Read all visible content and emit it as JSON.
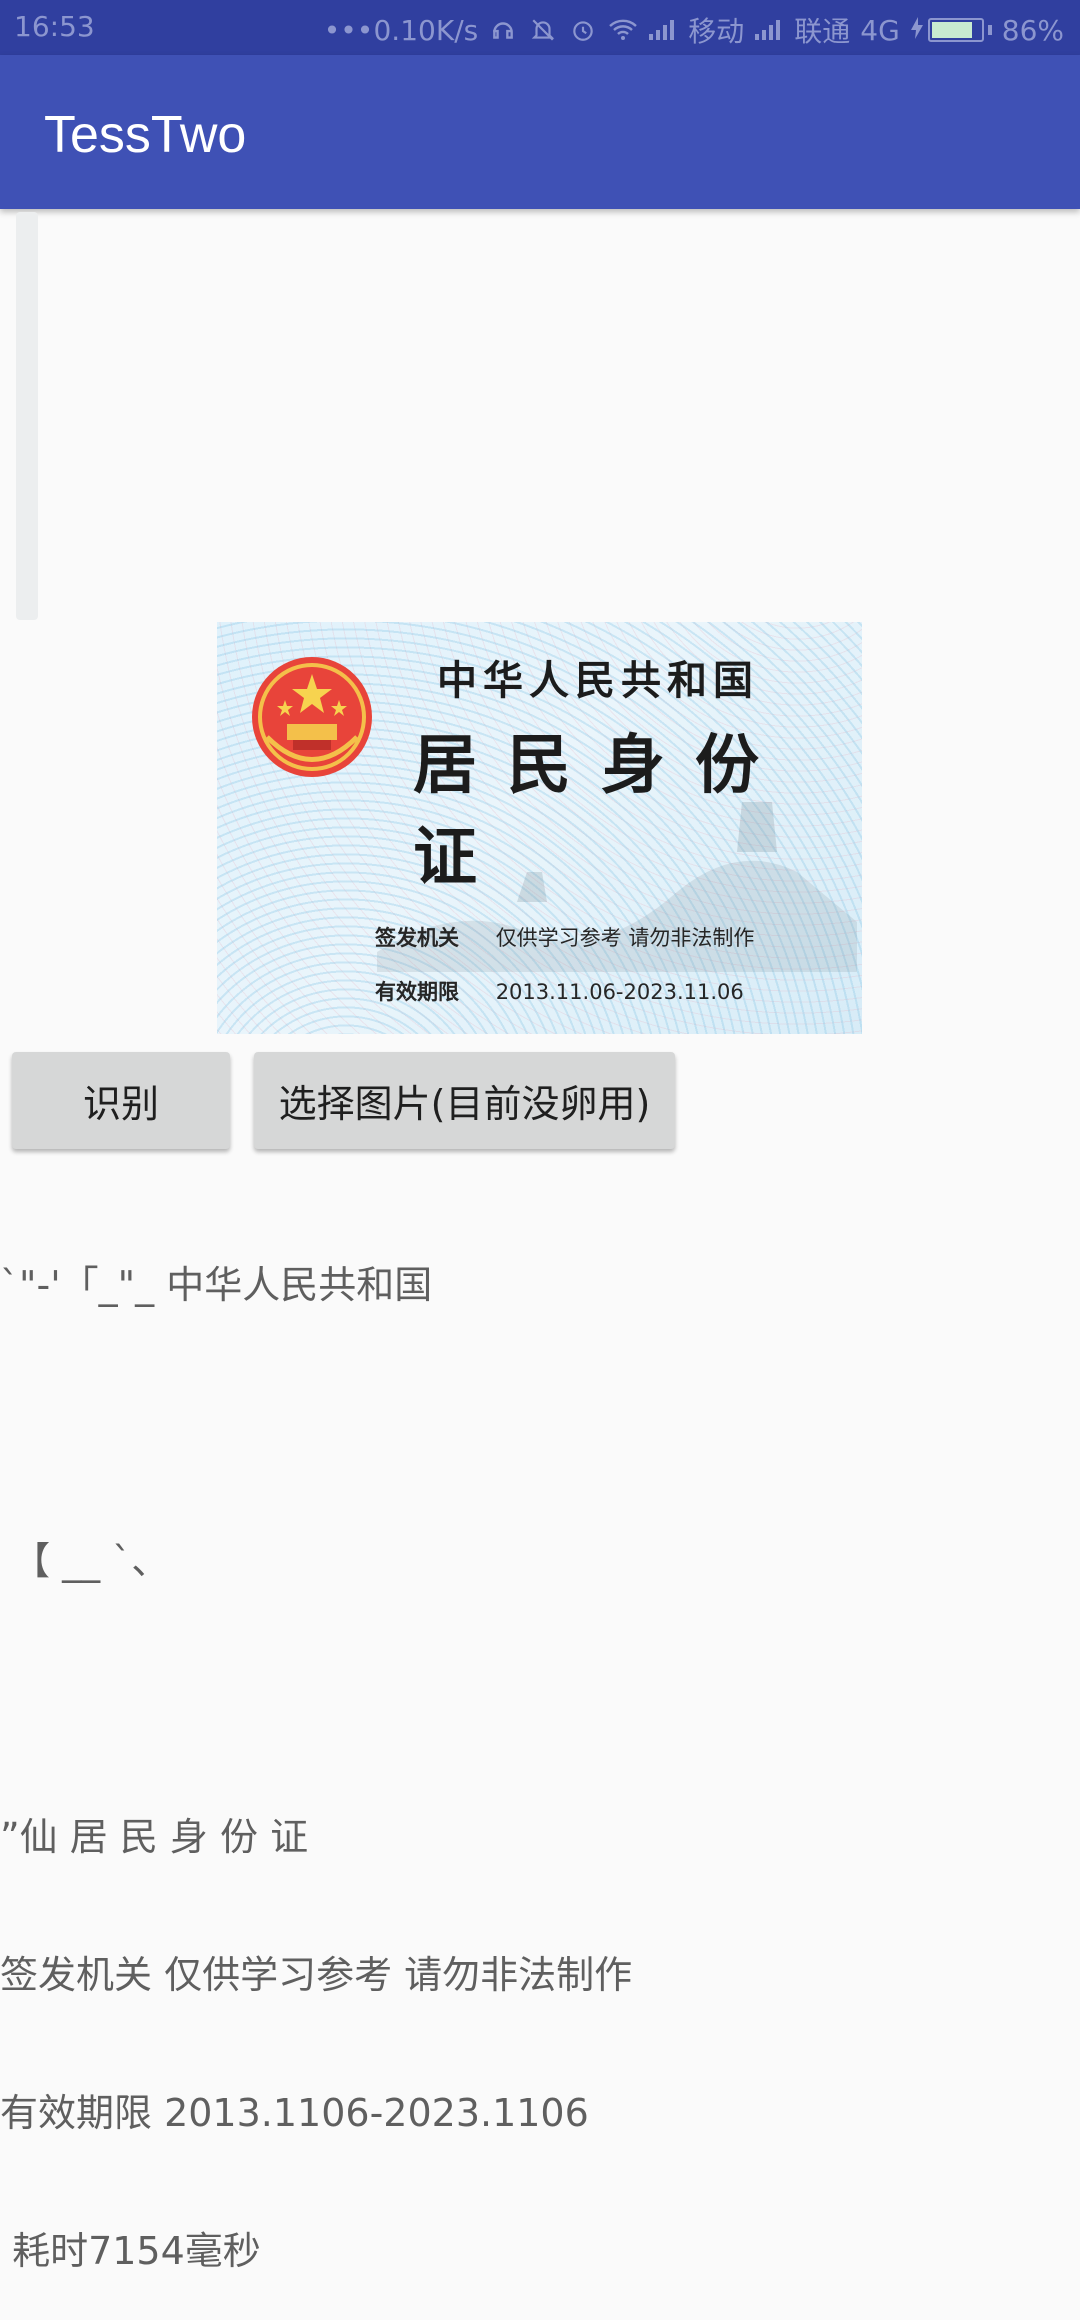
{
  "status_bar": {
    "time": "16:53",
    "network_speed": "0.10K/s",
    "carrier1": "移动",
    "carrier2": "联通",
    "network_type": "4G",
    "battery": "86%",
    "battery_level": 0.86,
    "icons": [
      "more-icon",
      "headset-icon",
      "mute-icon",
      "alarm-icon",
      "wifi-icon",
      "signal-icon",
      "signal-icon",
      "charging-icon",
      "battery-icon"
    ]
  },
  "app_bar": {
    "title": "TessTwo",
    "color": "#3f51b5"
  },
  "id_card": {
    "line1": "中华人民共和国",
    "line2": "居民身份证",
    "issuer_label": "签发机关",
    "issuer_value": "仅供学习参考 请勿非法制作",
    "validity_label": "有效期限",
    "validity_value": "2013.11.06-2023.11.06"
  },
  "buttons": {
    "recognize": "识别",
    "select_image": "选择图片(目前没卵用)"
  },
  "result": {
    "lines": [
      "`\"-'「_\"_ 中华人民共和国",
      "",
      " 【 __ `、",
      "",
      "”仙 居 民 身 份 证",
      "签发机关 仅供学习参考 请勿非法制作",
      "有效期限 2013.1106-2023.1106",
      " 耗时7154毫秒"
    ]
  }
}
